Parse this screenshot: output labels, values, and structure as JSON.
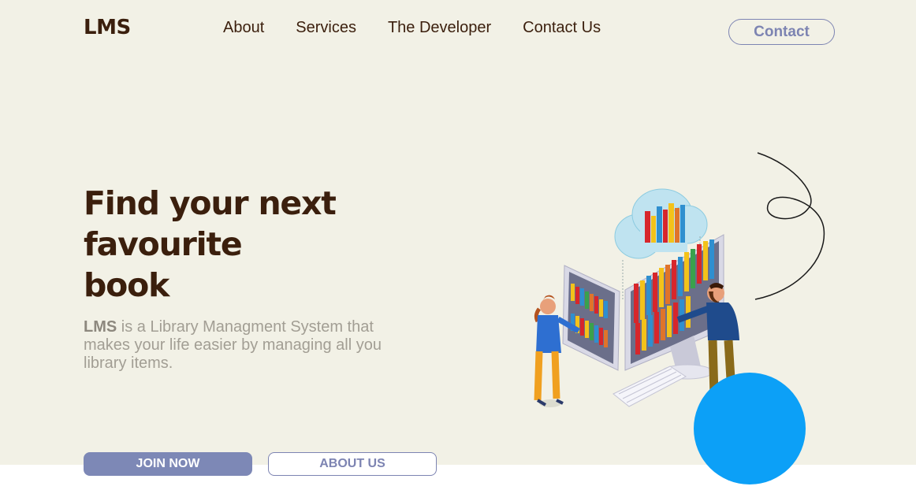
{
  "brand": {
    "logo": "LMS"
  },
  "nav": {
    "items": [
      "About",
      "Services",
      "The Developer",
      "Contact Us"
    ]
  },
  "header": {
    "contact_button": "Contact"
  },
  "hero": {
    "headline_lines": [
      "Find your next",
      "favourite",
      "book"
    ],
    "description_brand": "LMS",
    "description_rest": " is a Library Managment System that makes your life easier by managing all you library items.",
    "join_button": "JOIN NOW",
    "about_button": "ABOUT US"
  },
  "colors": {
    "background": "#f2f1e6",
    "heading": "#3b1f0d",
    "accent": "#7d84b2",
    "circle": "#0ca0f7",
    "description": "#a29e94"
  },
  "illustration": {
    "name": "library-illustration-icon"
  }
}
